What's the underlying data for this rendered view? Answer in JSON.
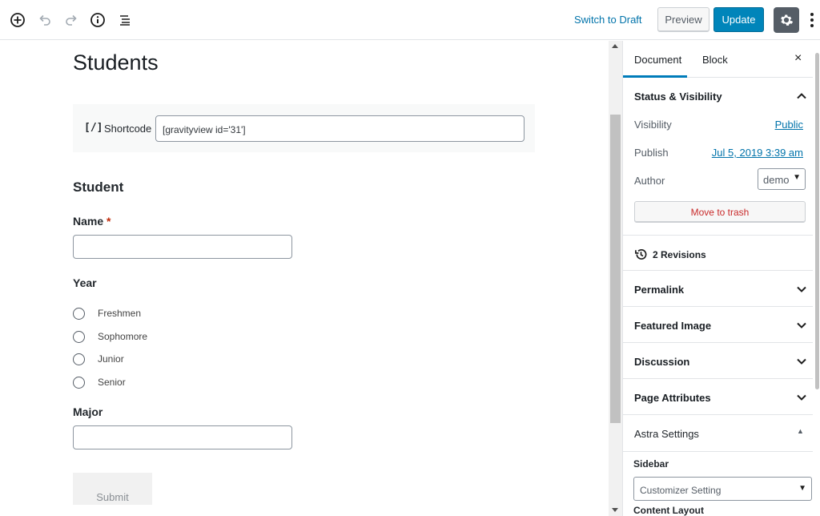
{
  "toolbar": {
    "icons": [
      "add-block-icon",
      "undo-icon",
      "redo-icon",
      "info-icon",
      "list-view-icon",
      "gear-icon",
      "more-menu-icon"
    ],
    "switch_to_draft": "Switch to Draft",
    "preview": "Preview",
    "update": "Update"
  },
  "editor": {
    "title": "Students",
    "shortcode": {
      "icon": "[/]",
      "label": "Shortcode",
      "value": "[gravityview id='31']"
    },
    "form": {
      "heading": "Student",
      "name_label": "Name",
      "required_mark": "*",
      "year_label": "Year",
      "year_options": [
        "Freshmen",
        "Sophomore",
        "Junior",
        "Senior"
      ],
      "major_label": "Major",
      "submit": "Submit"
    }
  },
  "sidebar": {
    "tabs": [
      "Document",
      "Block"
    ],
    "close": "×",
    "status_visibility": {
      "title": "Status & Visibility",
      "visibility_label": "Visibility",
      "visibility_value": "Public",
      "publish_label": "Publish",
      "publish_value": "Jul 5, 2019 3:39 am",
      "author_label": "Author",
      "author_value": "demo",
      "trash": "Move to trash"
    },
    "revisions": "2 Revisions",
    "panels": [
      "Permalink",
      "Featured Image",
      "Discussion",
      "Page Attributes"
    ],
    "astra": {
      "title": "Astra Settings",
      "sidebar_label": "Sidebar",
      "sidebar_value": "Customizer Setting",
      "content_layout_label": "Content Layout"
    }
  },
  "colors": {
    "accent": "#007cba",
    "update_button": "#0085ba",
    "link": "#0073aa",
    "trash": "#c92c2c",
    "required": "#c02b0a"
  }
}
